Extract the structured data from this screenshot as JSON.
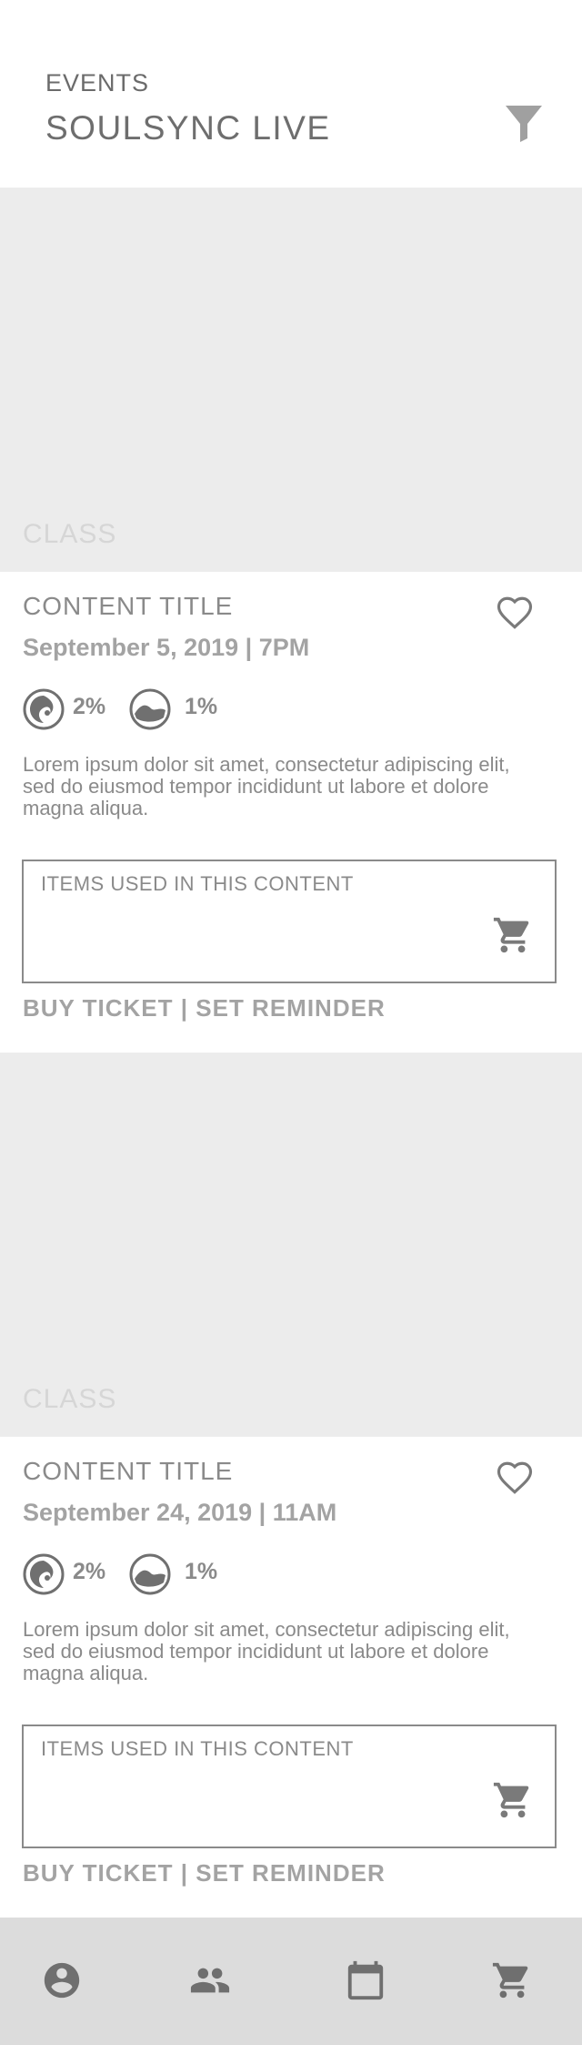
{
  "header": {
    "section": "EVENTS",
    "title": "SOULSYNC LIVE",
    "filter_icon": "filter-icon"
  },
  "cards": [
    {
      "hero_label": "CLASS",
      "title": "CONTENT TITLE",
      "date": "September 5, 2019 | 7PM",
      "stat1": "2%",
      "stat2": "1%",
      "description": "Lorem ipsum dolor sit amet, consectetur adipiscing elit, sed do eiusmod tempor incididunt ut labore et dolore magna aliqua.",
      "items_label": "ITEMS USED IN THIS CONTENT",
      "buy_label": "BUY TICKET",
      "separator": " | ",
      "reminder_label": "SET REMINDER"
    },
    {
      "hero_label": "CLASS",
      "title": "CONTENT TITLE",
      "date": "September 24, 2019 | 11AM",
      "stat1": "2%",
      "stat2": "1%",
      "description": "Lorem ipsum dolor sit amet, consectetur adipiscing elit, sed do eiusmod tempor incididunt ut labore et dolore magna aliqua.",
      "items_label": "ITEMS USED IN THIS CONTENT",
      "buy_label": "BUY TICKET",
      "separator": " | ",
      "reminder_label": "SET REMINDER"
    }
  ],
  "bottom_nav": {
    "items": [
      "profile-icon",
      "community-icon",
      "calendar-icon",
      "cart-icon"
    ]
  },
  "colors": {
    "hero_bg": "#ececec",
    "nav_bg": "#dcdcdc",
    "text": "#8a8a8a"
  }
}
